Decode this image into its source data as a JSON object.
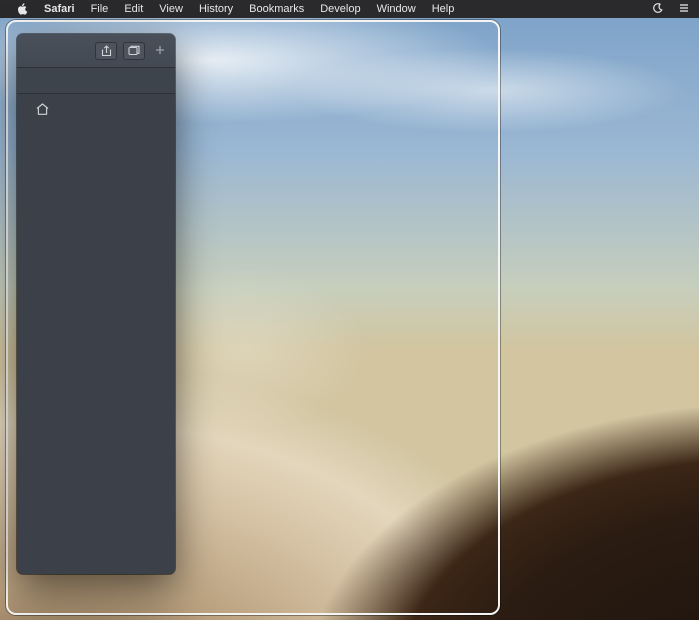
{
  "menubar": {
    "app_name": "Safari",
    "items": [
      "File",
      "Edit",
      "View",
      "History",
      "Bookmarks",
      "Develop",
      "Window",
      "Help"
    ]
  },
  "tray": {
    "dnd_icon": "do-not-disturb",
    "spotlight_icon": "spotlight"
  },
  "safari_window": {
    "toolbar": {
      "share_label": "Share",
      "tabs_overview_label": "Show Tab Overview",
      "new_tab_label": "New Tab"
    },
    "favorites": {
      "start_page_label": "Start Page"
    }
  }
}
